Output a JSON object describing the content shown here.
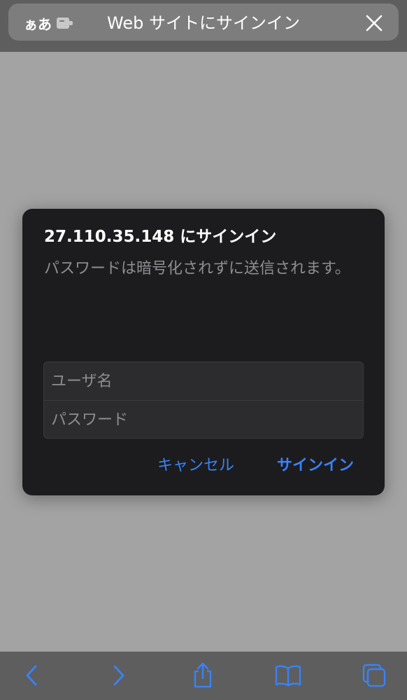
{
  "topbar": {
    "aa_label": "ぁあ",
    "title": "Web サイトにサインイン",
    "icons": [
      "extension-icon",
      "close-icon"
    ]
  },
  "dialog": {
    "title": "27.110.35.148 にサインイン",
    "message": "パスワードは暗号化されずに送信されます。",
    "username_placeholder": "ユーザ名",
    "password_placeholder": "パスワード",
    "cancel_label": "キャンセル",
    "signin_label": "サインイン"
  },
  "toolbar": {
    "icons": [
      "back-icon",
      "forward-icon",
      "share-icon",
      "bookmarks-icon",
      "tabs-icon"
    ]
  },
  "colors": {
    "accent": "#3a82f7",
    "dialog_bg": "#1c1c1e",
    "page_bg": "#a3a3a3",
    "bar_bg": "#5e5e5e"
  }
}
